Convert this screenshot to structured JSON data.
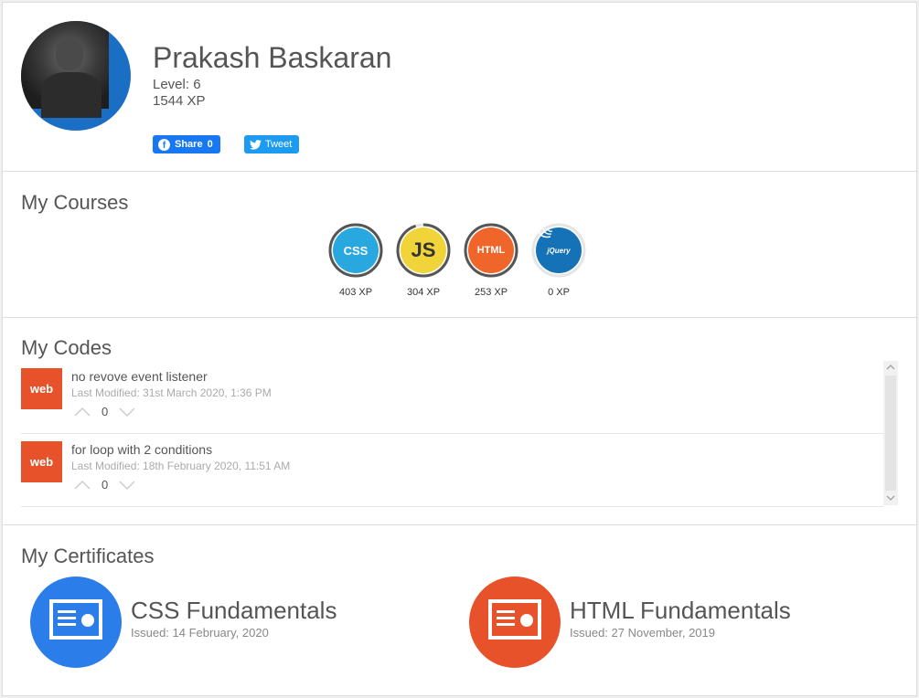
{
  "profile": {
    "name": "Prakash Baskaran",
    "level": "Level: 6",
    "xp": "1544 XP",
    "share_label": "Share",
    "share_count": "0",
    "tweet_label": "Tweet"
  },
  "courses": {
    "title": "My Courses",
    "items": [
      {
        "badge": "CSS",
        "xp": "403 XP",
        "color": "#29a8e0",
        "progress": 1.0
      },
      {
        "badge": "JS",
        "xp": "304 XP",
        "color": "#f0d43a",
        "progress": 0.95
      },
      {
        "badge": "HTML",
        "xp": "253 XP",
        "color": "#f06529",
        "progress": 1.0
      },
      {
        "badge": "jQuery",
        "xp": "0 XP",
        "color": "#1572b6",
        "progress": 0.0
      }
    ]
  },
  "codes": {
    "title": "My Codes",
    "items": [
      {
        "badge": "web",
        "title": "no revove event listener",
        "modified": "Last Modified: 31st March 2020, 1:36 PM",
        "votes": "0"
      },
      {
        "badge": "web",
        "title": "for loop with 2 conditions",
        "modified": "Last Modified: 18th February 2020, 11:51 AM",
        "votes": "0"
      }
    ]
  },
  "certificates": {
    "title": "My Certificates",
    "items": [
      {
        "title": "CSS Fundamentals",
        "issued": "Issued: 14 February, 2020",
        "color": "#2b7de9"
      },
      {
        "title": "HTML Fundamentals",
        "issued": "Issued: 27 November, 2019",
        "color": "#e8522a"
      }
    ]
  }
}
